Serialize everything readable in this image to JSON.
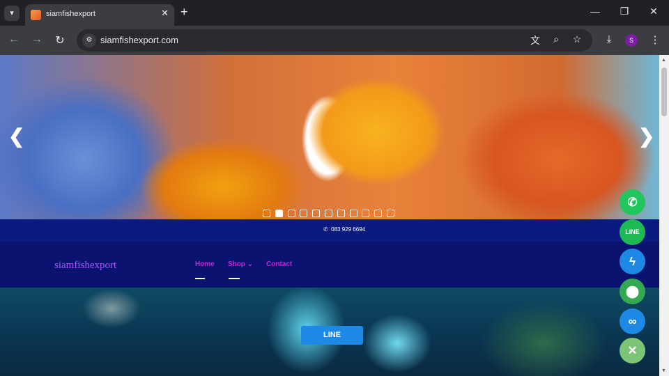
{
  "browser": {
    "tab_title": "siamfishexport",
    "url": "siamfishexport.com",
    "profile_initial": "S"
  },
  "hero": {
    "slide_count": 11,
    "active_slide": 2
  },
  "topbar": {
    "phone": "083 929 6694"
  },
  "nav": {
    "brand": "siamfishexport",
    "home": "Home",
    "shop": "Shop",
    "contact": "Contact"
  },
  "cta": {
    "line_button": "LINE"
  },
  "colors": {
    "brand": "#a855f7",
    "nav_link": "#c026d3",
    "navbar_bg": "#0a1470",
    "line_button": "#1e88e5",
    "fab_phone": "#22c55e",
    "fab_line": "#1db954",
    "fab_messenger": "#1e88e5",
    "fab_map": "#34a853",
    "fab_link": "#1e88e5",
    "fab_close": "#7cc576"
  },
  "fabs": [
    "phone-icon",
    "line-icon",
    "messenger-icon",
    "map-pin-icon",
    "link-icon",
    "close-icon"
  ]
}
